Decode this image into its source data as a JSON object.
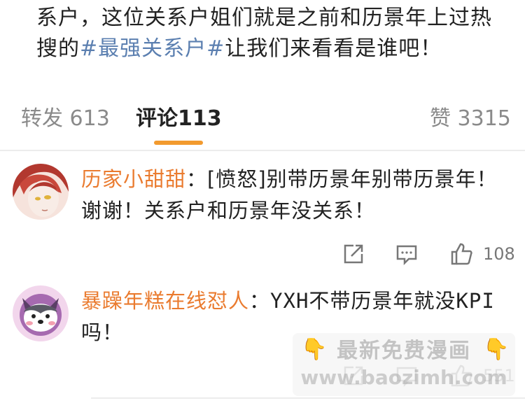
{
  "post": {
    "line1": "系户，这位关系户姐们就是之前和历景年上过热",
    "line2_prefix": "搜的",
    "hashtag": "#最强关系户#",
    "line2_suffix": "让我们来看看是谁吧！"
  },
  "tabs": {
    "repost_label": "转发",
    "repost_count": "613",
    "comment_label": "评论",
    "comment_count": "113",
    "like_label": "赞",
    "like_count": "3315"
  },
  "comments": [
    {
      "username": "历家小甜甜",
      "separator": "：",
      "text_line1": "[愤怒]别带历景年别带历景年！",
      "text_line2": "谢谢！关系户和历景年没关系！",
      "likes": "108",
      "icons": [
        "share-icon",
        "comment-icon",
        "thumbs-up-icon"
      ]
    },
    {
      "username": "暴躁年糕在线怼人",
      "separator": "：",
      "text_line1": "YXH不带历景年就没KPI",
      "text_line2": "吗！",
      "likes": "551",
      "icons": [
        "share-icon",
        "comment-icon",
        "thumbs-up-icon"
      ]
    }
  ],
  "watermark": {
    "line1": "最新免费漫画",
    "line2": "www.baozimh.com",
    "hand_icon": "pointing-hand-icon"
  },
  "colors": {
    "accent": "#f29a2e",
    "username": "#ea7b2f",
    "hashtag": "#5b7fb0",
    "muted": "#8a8a8a"
  }
}
